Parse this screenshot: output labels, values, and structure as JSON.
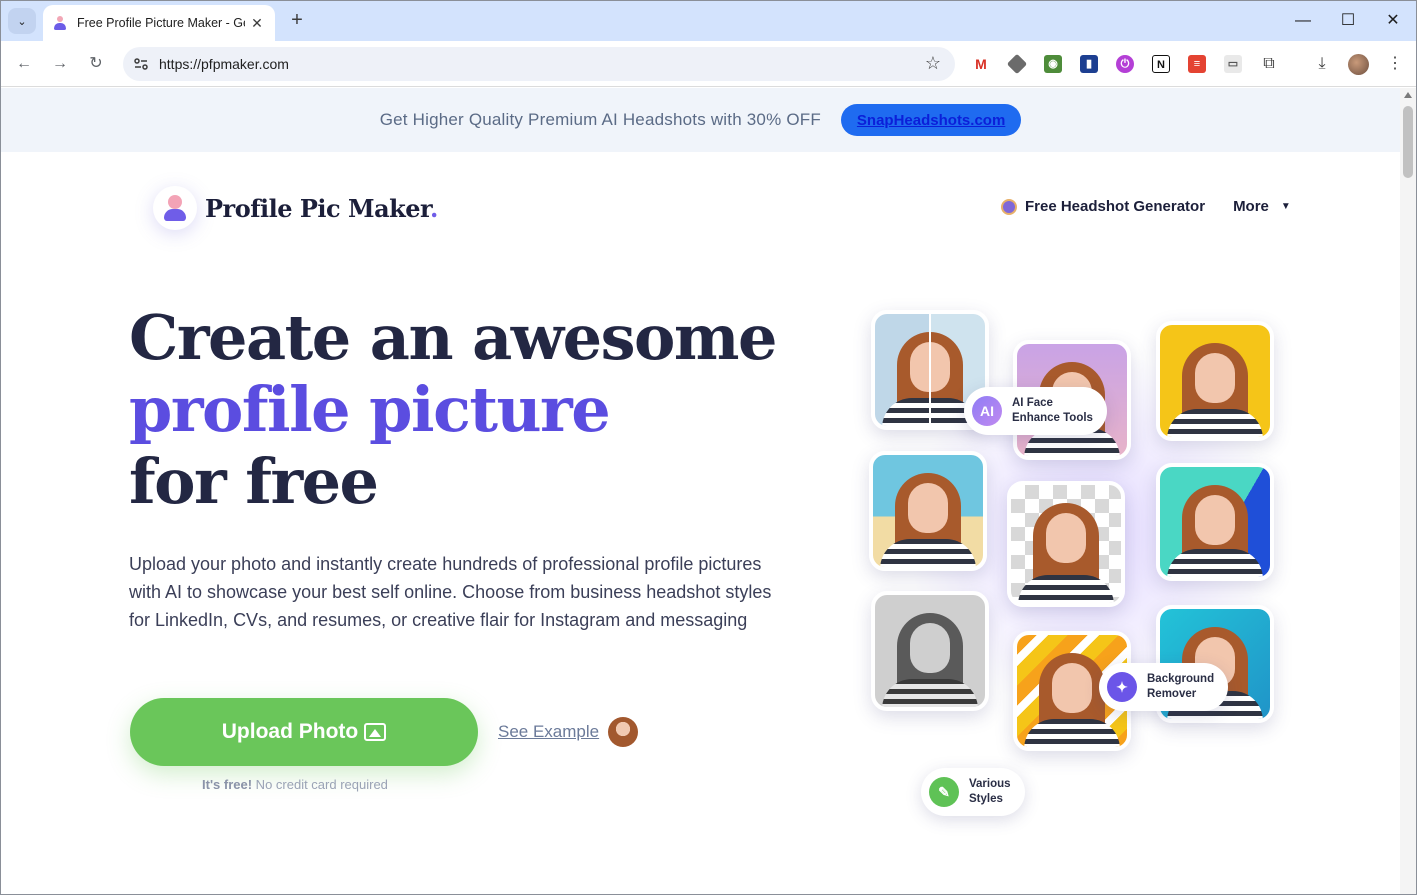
{
  "browser": {
    "tab_title": "Free Profile Picture Maker - Ge",
    "tab_close": "✕",
    "new_tab": "+",
    "url": "https://pfpmaker.com",
    "window_controls": {
      "minimize": "—",
      "maximize": "☐",
      "close": "✕"
    }
  },
  "promo": {
    "text": "Get Higher Quality Premium AI Headshots with 30% OFF",
    "button_label": "SnapHeadshots.com"
  },
  "brand": {
    "name": "Profile Pic Maker",
    "dot": "."
  },
  "nav": {
    "headshot_label": "Free Headshot Generator",
    "more_label": "More",
    "more_caret": "▼"
  },
  "hero": {
    "title_line1": "Create an awesome",
    "title_line2": "profile picture",
    "title_line3": "for free",
    "description": "Upload your photo and instantly create hundreds of professional profile pictures with AI to showcase your best self online. Choose from business headshot styles for LinkedIn, CVs, and resumes, or creative flair for Instagram and messaging",
    "upload_label": "Upload Photo",
    "see_example_label": "See Example",
    "free_bold": "It's free!",
    "free_rest": " No credit card required"
  },
  "collage": {
    "badge_ai_icon": "AI",
    "badge_ai_line1": "AI Face",
    "badge_ai_line2": "Enhance Tools",
    "badge_bg_line1": "Background",
    "badge_bg_line2": "Remover",
    "badge_styles_line1": "Various",
    "badge_styles_line2": "Styles"
  },
  "colors": {
    "accent": "#5b4de0",
    "promo_button": "#1f6bf0",
    "upload_button": "#6ac65a",
    "heading": "#232743"
  }
}
